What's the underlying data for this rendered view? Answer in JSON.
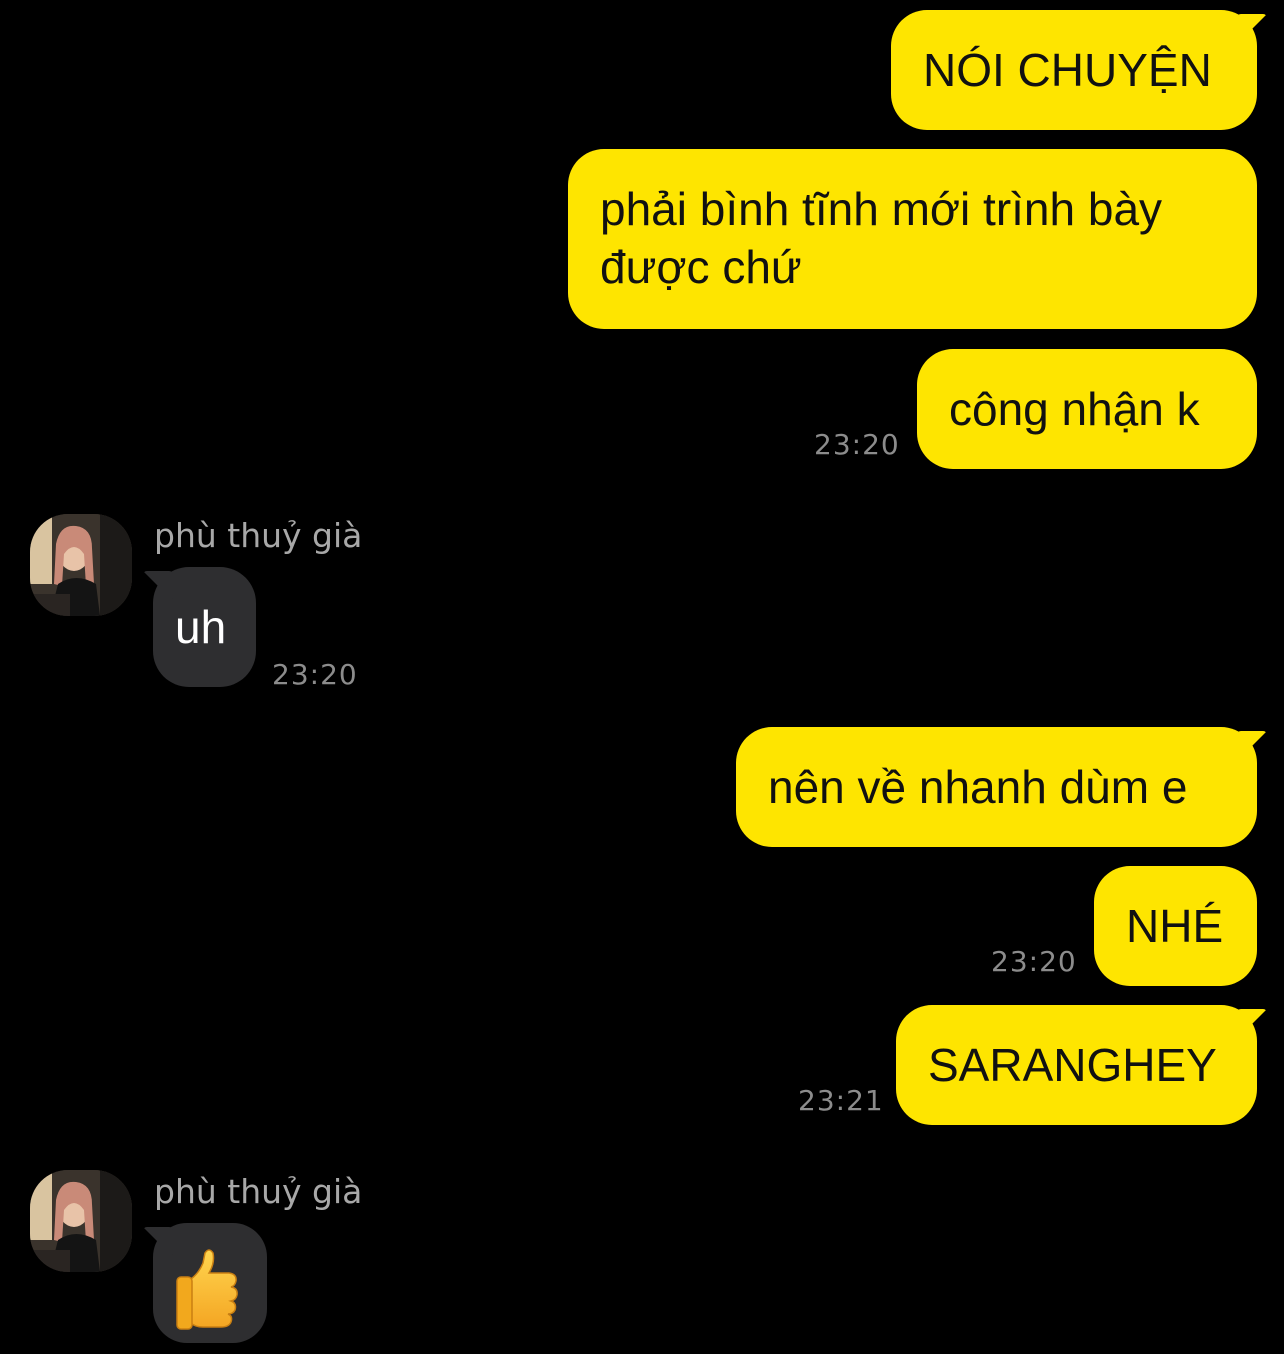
{
  "chat": {
    "messages": [
      {
        "sender": "me",
        "text": "NÓI CHUYỆN"
      },
      {
        "sender": "me",
        "text": "phải bình tĩnh mới trình bày được chứ"
      },
      {
        "sender": "me",
        "text": "công nhận k",
        "time": "23:20"
      },
      {
        "sender": "phù thuỷ già",
        "text": "uh",
        "time": "23:20"
      },
      {
        "sender": "me",
        "text": "nên về nhanh dùm e"
      },
      {
        "sender": "me",
        "text": "NHÉ",
        "time": "23:20"
      },
      {
        "sender": "me",
        "text": "SARANGHEY",
        "time": "23:21"
      },
      {
        "sender": "phù thuỷ già",
        "text": "👍",
        "icon": "thumbs-up-emoji"
      }
    ]
  },
  "colors": {
    "background": "#000000",
    "my_bubble": "#FEE500",
    "their_bubble": "#2E2E30",
    "timestamp": "#8C8C8C",
    "sender_name": "#A8A8A8"
  }
}
